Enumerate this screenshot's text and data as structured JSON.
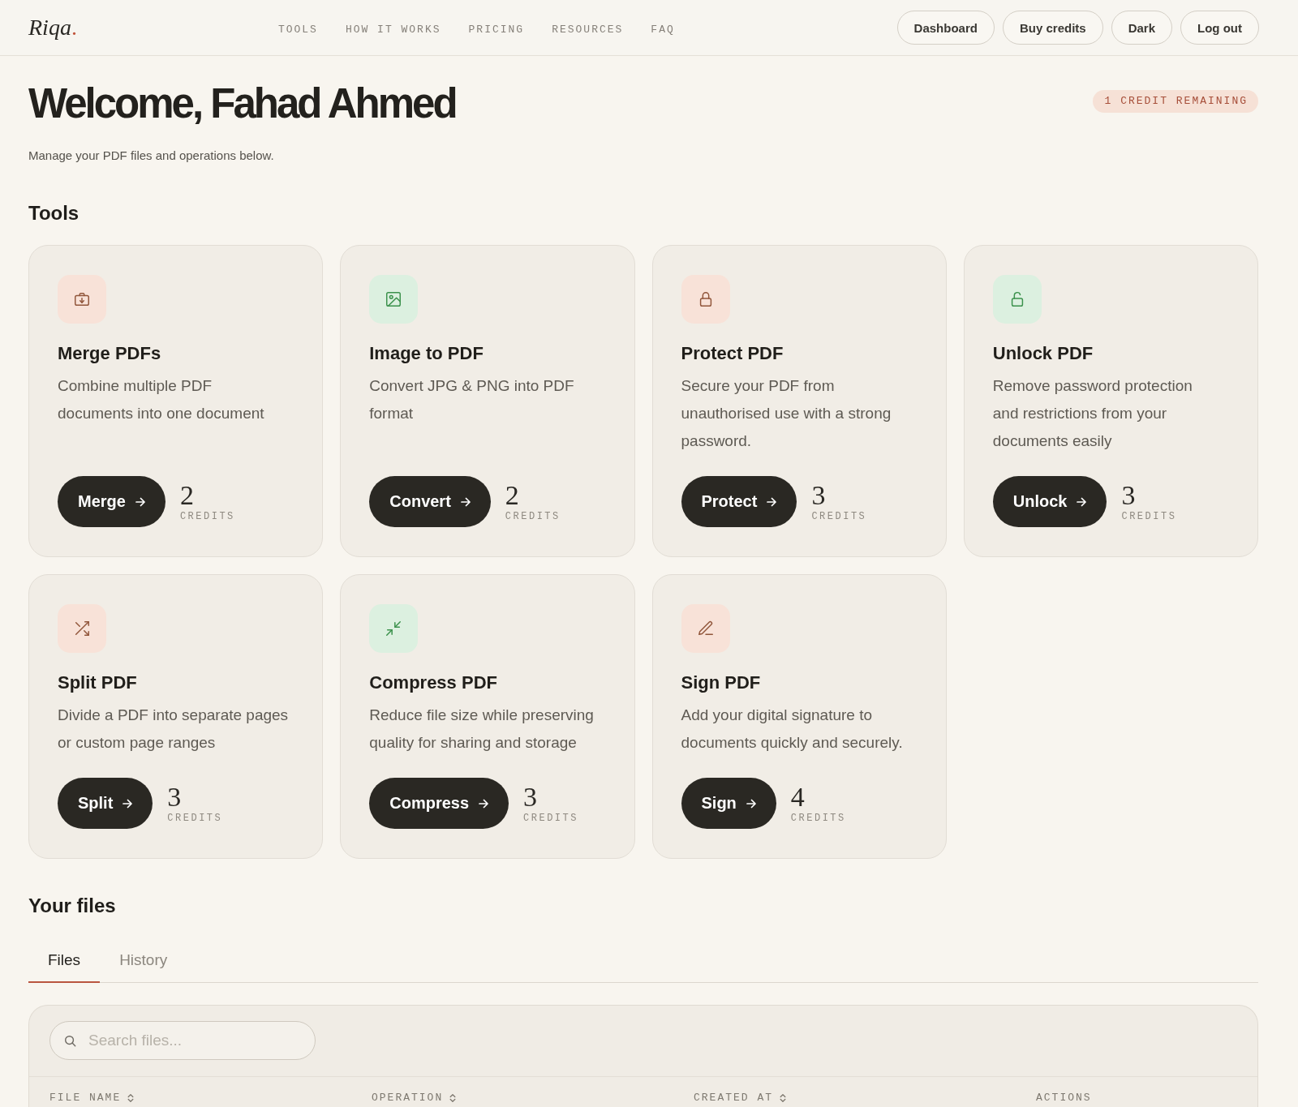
{
  "header": {
    "logo": {
      "name": "Riqa",
      "mark": "."
    },
    "nav": [
      "TOOLS",
      "HOW IT WORKS",
      "PRICING",
      "RESOURCES",
      "FAQ"
    ],
    "buttons": [
      "Dashboard",
      "Buy credits",
      "Dark",
      "Log out"
    ]
  },
  "welcome": {
    "title": "Welcome, Fahad Ahmed",
    "subtitle": "Manage your PDF files and operations below.",
    "credit_badge": "1 CREDIT REMAINING"
  },
  "tools": {
    "heading": "Tools",
    "cards": [
      {
        "kind": "merge",
        "color": "#f8e2d8",
        "title": "Merge PDFs",
        "description": "Combine multiple PDF\ndocuments into one document",
        "button": "Merge",
        "credits": "2",
        "credits_label": "CREDITS"
      },
      {
        "kind": "image",
        "color": "#dcf0e0",
        "title": "Image to PDF",
        "description": "Convert JPG & PNG into PDF\nformat",
        "button": "Convert",
        "credits": "2",
        "credits_label": "CREDITS"
      },
      {
        "kind": "protect",
        "color": "#f8e2d8",
        "title": "Protect PDF",
        "description": "Secure your PDF from\nunauthorised use with a strong\npassword.",
        "button": "Protect",
        "credits": "3",
        "credits_label": "CREDITS"
      },
      {
        "kind": "unlock",
        "color": "#dcf0e0",
        "title": "Unlock PDF",
        "description": "Remove password protection\nand restrictions from your\ndocuments easily",
        "button": "Unlock",
        "credits": "3",
        "credits_label": "CREDITS"
      },
      {
        "kind": "split",
        "color": "#f8e2d8",
        "title": "Split PDF",
        "description": "Divide a PDF into separate pages\nor custom page ranges",
        "button": "Split",
        "credits": "3",
        "credits_label": "CREDITS"
      },
      {
        "kind": "compress",
        "color": "#dcf0e0",
        "title": "Compress PDF",
        "description": "Reduce file size while preserving\nquality for sharing and storage",
        "button": "Compress",
        "credits": "3",
        "credits_label": "CREDITS"
      },
      {
        "kind": "sign",
        "color": "#f8e2d8",
        "title": "Sign PDF",
        "description": "Add your digital signature to\ndocuments quickly and securely.",
        "button": "Sign",
        "credits": "4",
        "credits_label": "CREDITS"
      }
    ]
  },
  "files": {
    "heading": "Your files",
    "tabs": [
      {
        "label": "Files",
        "selected": true
      },
      {
        "label": "History",
        "selected": false
      }
    ],
    "search": {
      "placeholder": "Search files..."
    },
    "table": {
      "columns": [
        {
          "label": "FILE NAME",
          "sortable": true
        },
        {
          "label": "OPERATION",
          "sortable": true
        },
        {
          "label": "CREATED AT",
          "sortable": true
        },
        {
          "label": "ACTIONS",
          "sortable": false
        }
      ]
    }
  }
}
